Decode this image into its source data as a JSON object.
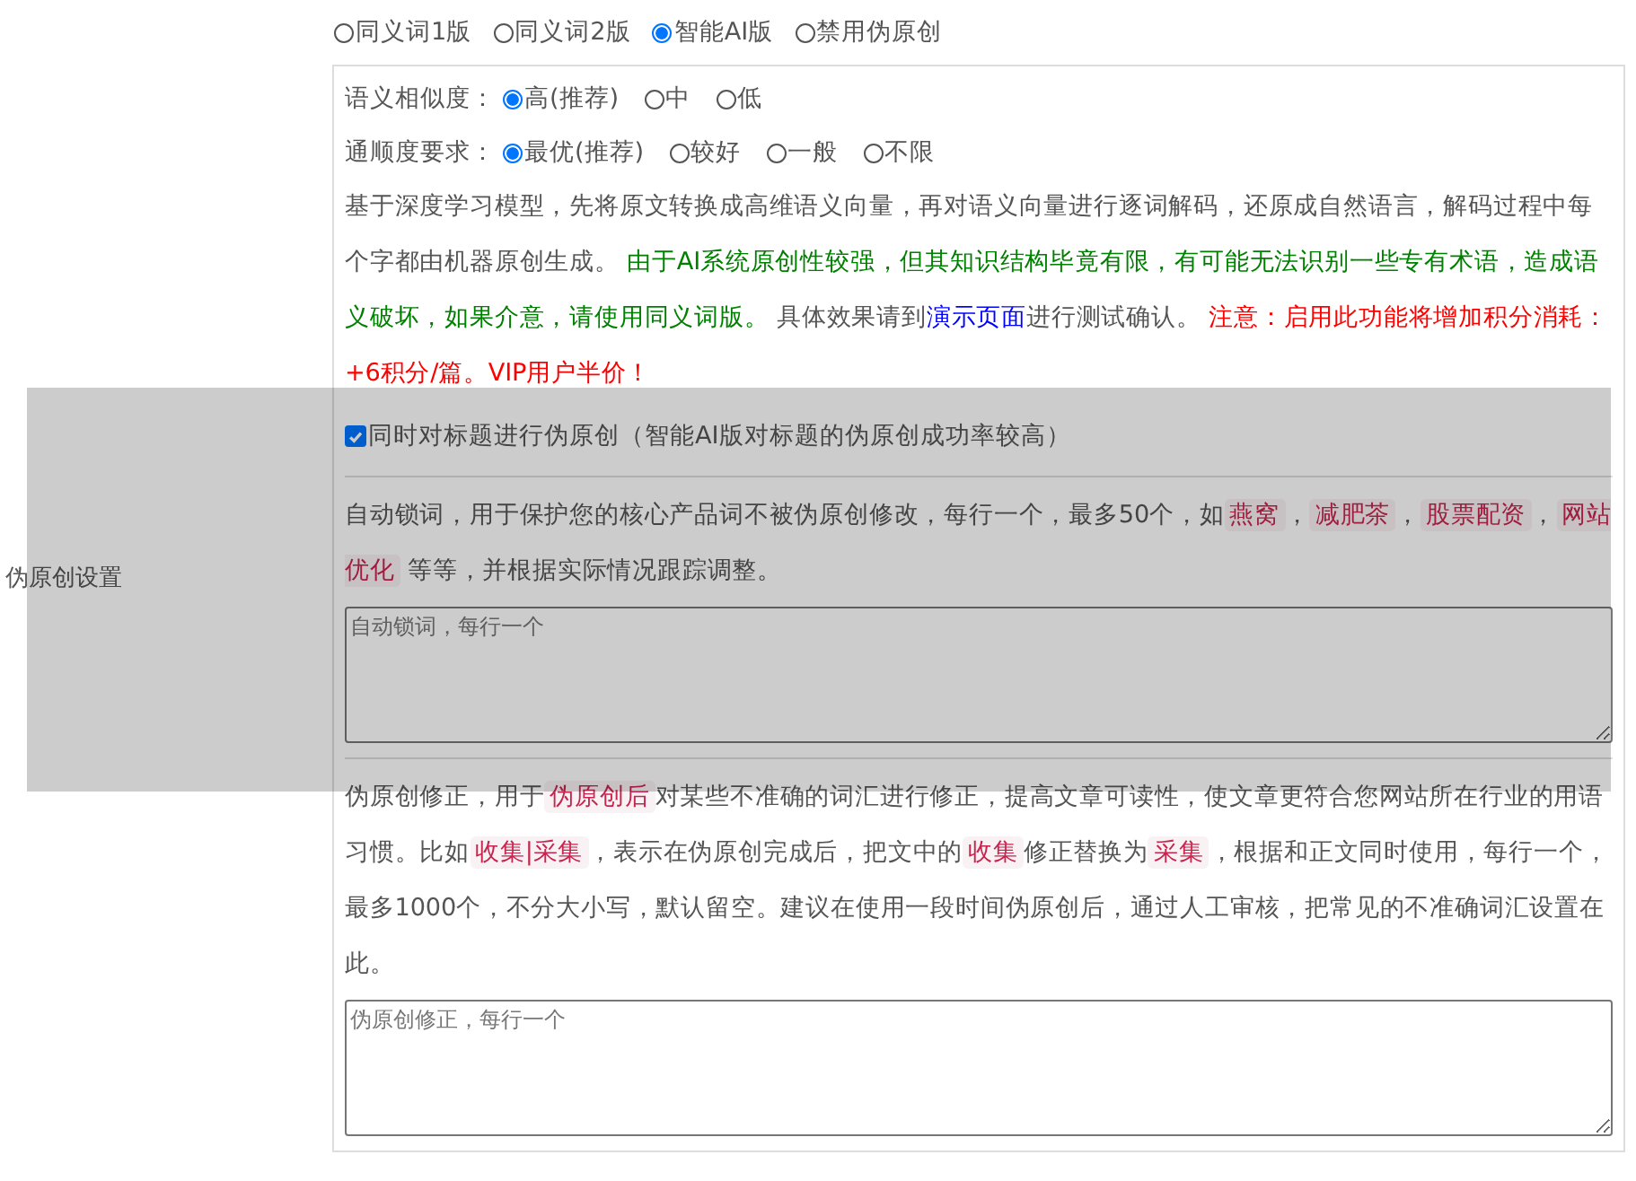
{
  "section_label": "伪原创设置",
  "version_options": [
    {
      "label": "同义词1版",
      "selected": false
    },
    {
      "label": "同义词2版",
      "selected": false
    },
    {
      "label": "智能AI版",
      "selected": true
    },
    {
      "label": "禁用伪原创",
      "selected": false
    }
  ],
  "ai_settings": {
    "similarity": {
      "label": "语义相似度：",
      "options": [
        {
          "label": "高(推荐)",
          "selected": true
        },
        {
          "label": "中",
          "selected": false
        },
        {
          "label": "低",
          "selected": false
        }
      ]
    },
    "fluency": {
      "label": "通顺度要求：",
      "options": [
        {
          "label": "最优(推荐)",
          "selected": true
        },
        {
          "label": "较好",
          "selected": false
        },
        {
          "label": "一般",
          "selected": false
        },
        {
          "label": "不限",
          "selected": false
        }
      ]
    },
    "description": [
      {
        "kind": "plain",
        "text": "基于深度学习模型，先将原文转换成高维语义向量，再对语义向量进行逐词解码，还原成自然语言，解码过程中每个字都由机器原创生成。 "
      },
      {
        "kind": "green",
        "text": "由于AI系统原创性较强，但其知识结构毕竟有限，有可能无法识别一些专有术语，造成语义破坏，如果介意，请使用同义词版。"
      },
      {
        "kind": "plain",
        "text": " 具体效果请到"
      },
      {
        "kind": "link",
        "text": "演示页面"
      },
      {
        "kind": "plain",
        "text": "进行测试确认。 "
      },
      {
        "kind": "red",
        "text": "注意：启用此功能将增加积分消耗：+6积分/篇。VIP用户半价！"
      }
    ]
  },
  "title_rewrite": {
    "checked": true,
    "label": "同时对标题进行伪原创（智能AI版对标题的伪原创成功率较高）"
  },
  "lock_words": {
    "description": [
      {
        "kind": "plain",
        "text": "自动锁词，用于保护您的核心产品词不被伪原创修改，每行一个，最多50个，如"
      },
      {
        "kind": "tag",
        "text": "燕窝"
      },
      {
        "kind": "plain",
        "text": "，"
      },
      {
        "kind": "tag",
        "text": "减肥茶"
      },
      {
        "kind": "plain",
        "text": "，"
      },
      {
        "kind": "tag",
        "text": "股票配资"
      },
      {
        "kind": "plain",
        "text": "，"
      },
      {
        "kind": "tag",
        "text": "网站优化"
      },
      {
        "kind": "plain",
        "text": " 等等，并根据实际情况跟踪调整。"
      }
    ],
    "placeholder": "自动锁词，每行一个"
  },
  "corrections": {
    "description": [
      {
        "kind": "plain",
        "text": "伪原创修正，用于"
      },
      {
        "kind": "tag",
        "text": "伪原创后"
      },
      {
        "kind": "plain",
        "text": "对某些不准确的词汇进行修正，提高文章可读性，使文章更符合您网站所在行业的用语习惯。比如"
      },
      {
        "kind": "tag",
        "text": "收集|采集"
      },
      {
        "kind": "plain",
        "text": "，表示在伪原创完成后，把文中的"
      },
      {
        "kind": "tag",
        "text": "收集"
      },
      {
        "kind": "plain",
        "text": "修正替换为"
      },
      {
        "kind": "tag",
        "text": "采集"
      },
      {
        "kind": "plain",
        "text": "，根据和正文同时使用，每行一个，最多1000个，不分大小写，默认留空。建议在使用一段时间伪原创后，通过人工审核，把常见的不准确词汇设置在此。"
      }
    ],
    "placeholder": "伪原创修正，每行一个"
  }
}
